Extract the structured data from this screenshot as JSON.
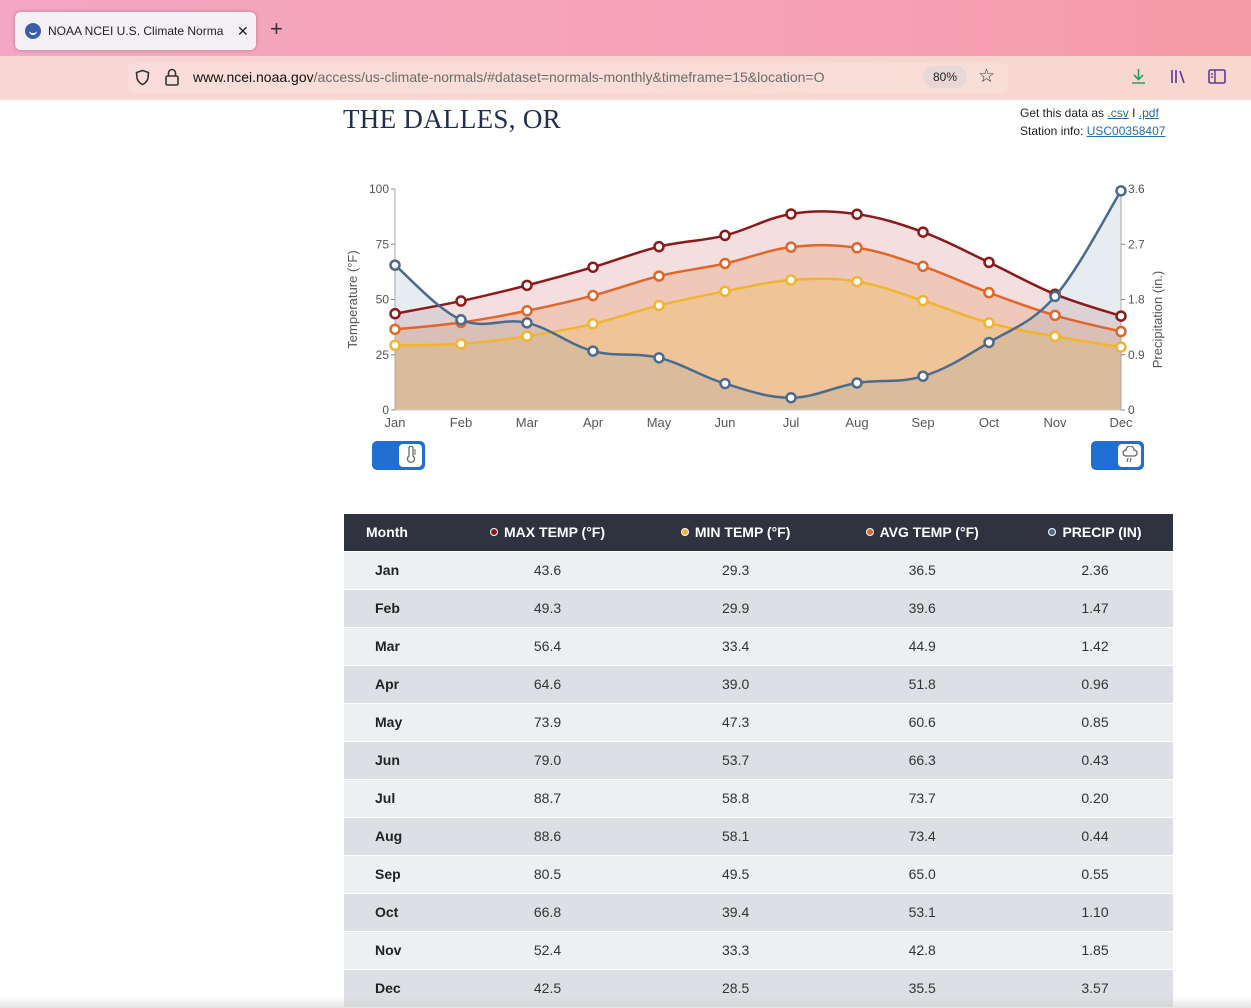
{
  "browser": {
    "tab_title": "NOAA NCEI U.S. Climate Norma",
    "url_host": "www.ncei.noaa.gov",
    "url_path": "/access/us-climate-normals/#dataset=normals-monthly&timeframe=15&location=O",
    "zoom": "80%"
  },
  "header": {
    "station_title": "THE DALLES, OR",
    "get_data_prefix": "Get this data as",
    "csv_link": ".csv",
    "separator": "I",
    "pdf_link": ".pdf",
    "station_info_prefix": "Station info:",
    "station_id": "USC00358407"
  },
  "colors": {
    "max_temp": "#8b1a1a",
    "avg_temp": "#e0662a",
    "min_temp": "#f0b430",
    "precip": "#4a6b8e",
    "toggle": "#1e6fd1"
  },
  "chart_data": {
    "type": "line",
    "categories": [
      "Jan",
      "Feb",
      "Mar",
      "Apr",
      "May",
      "Jun",
      "Jul",
      "Aug",
      "Sep",
      "Oct",
      "Nov",
      "Dec"
    ],
    "ylabel": "Temperature (°F)",
    "y2label": "Precipitation (in.)",
    "ylim": [
      0,
      100
    ],
    "y2lim": [
      0,
      3.6
    ],
    "yticks": [
      "0",
      "25",
      "50",
      "75",
      "100"
    ],
    "y2ticks": [
      "0",
      "0.9",
      "1.8",
      "2.7",
      "3.6"
    ],
    "grid": false,
    "series": [
      {
        "name": "MAX TEMP (°F)",
        "axis": "left",
        "values": [
          43.6,
          49.3,
          56.4,
          64.6,
          73.9,
          79.0,
          88.7,
          88.6,
          80.5,
          66.8,
          52.4,
          42.5
        ]
      },
      {
        "name": "AVG TEMP (°F)",
        "axis": "left",
        "values": [
          36.5,
          39.6,
          44.9,
          51.8,
          60.6,
          66.3,
          73.7,
          73.4,
          65.0,
          53.1,
          42.8,
          35.5
        ]
      },
      {
        "name": "MIN TEMP (°F)",
        "axis": "left",
        "values": [
          29.3,
          29.9,
          33.4,
          39.0,
          47.3,
          53.7,
          58.8,
          58.1,
          49.5,
          39.4,
          33.3,
          28.5
        ]
      },
      {
        "name": "PRECIP (IN)",
        "axis": "right",
        "values": [
          2.36,
          1.47,
          1.42,
          0.96,
          0.85,
          0.43,
          0.2,
          0.44,
          0.55,
          1.1,
          1.85,
          3.57
        ]
      }
    ]
  },
  "table": {
    "headers": [
      "Month",
      "MAX TEMP (°F)",
      "MIN TEMP (°F)",
      "AVG TEMP (°F)",
      "PRECIP (IN)"
    ],
    "rows": [
      [
        "Jan",
        "43.6",
        "29.3",
        "36.5",
        "2.36"
      ],
      [
        "Feb",
        "49.3",
        "29.9",
        "39.6",
        "1.47"
      ],
      [
        "Mar",
        "56.4",
        "33.4",
        "44.9",
        "1.42"
      ],
      [
        "Apr",
        "64.6",
        "39.0",
        "51.8",
        "0.96"
      ],
      [
        "May",
        "73.9",
        "47.3",
        "60.6",
        "0.85"
      ],
      [
        "Jun",
        "79.0",
        "53.7",
        "66.3",
        "0.43"
      ],
      [
        "Jul",
        "88.7",
        "58.8",
        "73.7",
        "0.20"
      ],
      [
        "Aug",
        "88.6",
        "58.1",
        "73.4",
        "0.44"
      ],
      [
        "Sep",
        "80.5",
        "49.5",
        "65.0",
        "0.55"
      ],
      [
        "Oct",
        "66.8",
        "39.4",
        "53.1",
        "1.10"
      ],
      [
        "Nov",
        "52.4",
        "33.3",
        "42.8",
        "1.85"
      ],
      [
        "Dec",
        "42.5",
        "28.5",
        "35.5",
        "3.57"
      ]
    ]
  },
  "icons": {
    "temp_toggle": "thermometer-icon",
    "precip_toggle": "cloud-rain-icon"
  }
}
